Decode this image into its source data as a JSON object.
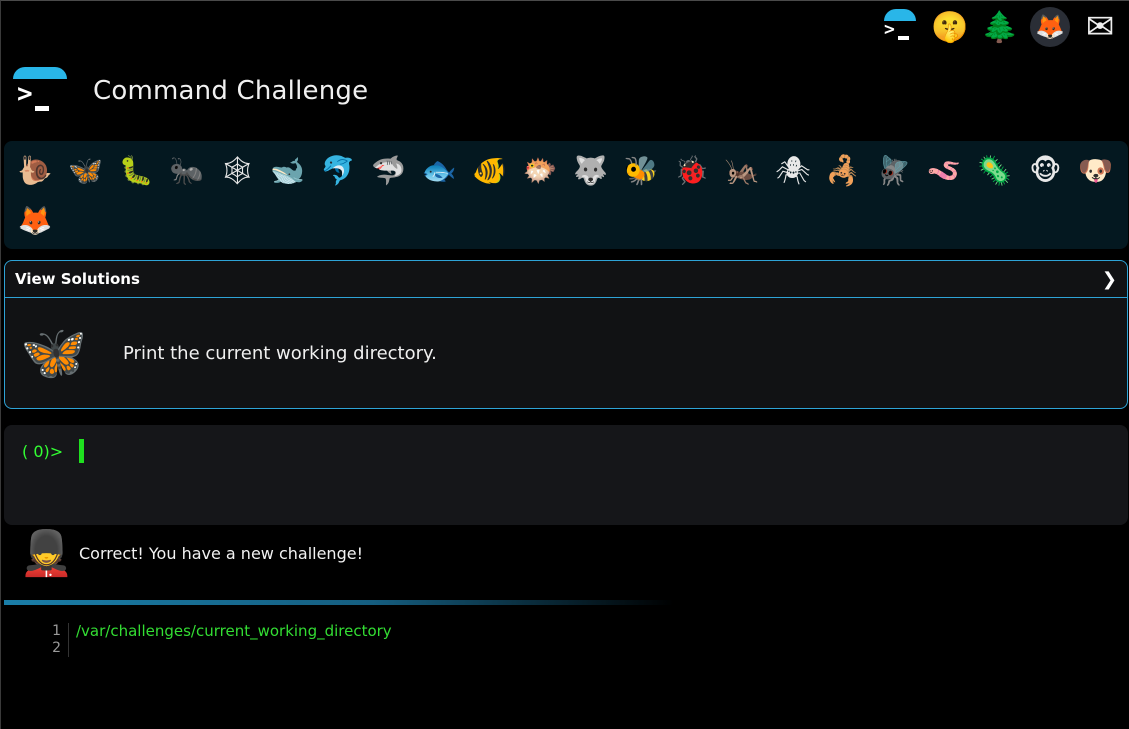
{
  "top_icons": [
    {
      "name": "prompt-logo-icon"
    },
    {
      "name": "shushing-face-icon",
      "glyph": "🤫"
    },
    {
      "name": "tree-icon",
      "glyph": "🌲"
    },
    {
      "name": "gitlab-fox-icon",
      "glyph": "🦊"
    },
    {
      "name": "envelope-icon",
      "glyph": "✉"
    }
  ],
  "header": {
    "title": "Command Challenge"
  },
  "animals": [
    {
      "name": "snail-icon",
      "glyph": "🐌"
    },
    {
      "name": "butterfly-icon",
      "glyph": "🦋"
    },
    {
      "name": "caterpillar-icon",
      "glyph": "🐛"
    },
    {
      "name": "ant-icon",
      "glyph": "🐜"
    },
    {
      "name": "spider-web-icon",
      "glyph": "🕸"
    },
    {
      "name": "whale-icon",
      "glyph": "🐋"
    },
    {
      "name": "dolphin-icon",
      "glyph": "🐬"
    },
    {
      "name": "shark-icon",
      "glyph": "🦈"
    },
    {
      "name": "fish-icon",
      "glyph": "🐟"
    },
    {
      "name": "tropical-fish-icon",
      "glyph": "🐠"
    },
    {
      "name": "blowfish-icon",
      "glyph": "🐡"
    },
    {
      "name": "wolf-icon",
      "glyph": "🐺"
    },
    {
      "name": "bee-icon",
      "glyph": "🐝"
    },
    {
      "name": "ladybug-icon",
      "glyph": "🐞"
    },
    {
      "name": "cricket-icon",
      "glyph": "🦗"
    },
    {
      "name": "spider-icon",
      "glyph": "🕷"
    },
    {
      "name": "scorpion-icon",
      "glyph": "🦂"
    },
    {
      "name": "fly-icon",
      "glyph": "🪰"
    },
    {
      "name": "worm-icon",
      "glyph": "🪱"
    },
    {
      "name": "microbe-icon",
      "glyph": "🦠"
    },
    {
      "name": "monkey-icon",
      "glyph": "🐵"
    },
    {
      "name": "dog-icon",
      "glyph": "🐶"
    },
    {
      "name": "fox-icon",
      "glyph": "🦊"
    }
  ],
  "challenge": {
    "header_label": "View Solutions",
    "chevron": "❯",
    "moth_glyph": "🦋",
    "description": "Print the current working directory."
  },
  "terminal": {
    "prompt": "( 0)>"
  },
  "response": {
    "guard_glyph": "💂",
    "text": "Correct! You have a new challenge!"
  },
  "output": {
    "lines": [
      {
        "num": "1",
        "text": "/var/challenges/current_working_directory"
      },
      {
        "num": "2",
        "text": ""
      }
    ]
  },
  "colors": {
    "accent": "#2ea3d6",
    "terminal_green": "#33ff33",
    "background": "#000000"
  }
}
